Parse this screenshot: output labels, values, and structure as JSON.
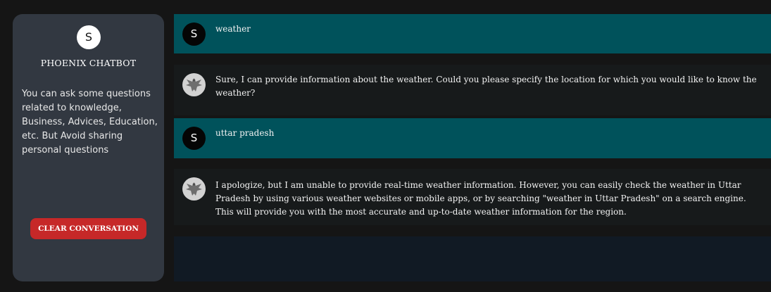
{
  "sidebar": {
    "avatar_letter": "S",
    "title": "PHOENIX CHATBOT",
    "description": "You can ask some questions related to knowledge, Business, Advices, Education, etc. But Avoid sharing personal questions",
    "clear_button": "CLEAR CONVERSATION"
  },
  "messages": [
    {
      "role": "user",
      "avatar": "S",
      "text": "weather"
    },
    {
      "role": "bot",
      "avatar": "phoenix-logo",
      "text": "Sure, I can provide information about the weather. Could you please specify the location for which you would like to know the weather?"
    },
    {
      "role": "user",
      "avatar": "S",
      "text": "uttar pradesh"
    },
    {
      "role": "bot",
      "avatar": "phoenix-logo",
      "text": "I apologize, but I am unable to provide real-time weather information. However, you can easily check the weather in Uttar Pradesh by using various weather websites or mobile apps, or by searching \"weather in Uttar Pradesh\" on a search engine. This will provide you with the most accurate and up-to-date weather information for the region."
    }
  ],
  "colors": {
    "user_bubble": "#00525b",
    "bot_bubble": "#171a1b",
    "sidebar": "#323841",
    "clear_button": "#c62828"
  }
}
